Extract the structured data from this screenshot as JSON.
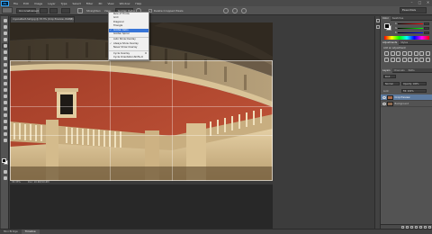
{
  "app": {
    "logo": "Ps"
  },
  "menubar": {
    "items": [
      "File",
      "Edit",
      "Image",
      "Layer",
      "Type",
      "Select",
      "Filter",
      "3D",
      "View",
      "Window",
      "Help"
    ],
    "window_controls": [
      "–",
      "□",
      "✕"
    ]
  },
  "options_bar": {
    "ratio": "Unconstrained",
    "straighten": "Straighten",
    "view": "View:",
    "view_value": "Golden Ratio",
    "delete_cropped": "Delete Cropped Pixels",
    "delete_cropped_checked": true,
    "workspace": "Essentials"
  },
  "overlay_menu": {
    "items": [
      {
        "label": "Rule of Thirds",
        "checked": false,
        "selected": false
      },
      {
        "label": "Grid",
        "checked": false,
        "selected": false
      },
      {
        "label": "Diagonal",
        "checked": false,
        "selected": false
      },
      {
        "label": "Triangle",
        "checked": false,
        "selected": false
      },
      {
        "label": "Golden Ratio",
        "checked": true,
        "selected": true
      },
      {
        "label": "Golden Spiral",
        "checked": false,
        "selected": false
      }
    ],
    "separator_after": 5,
    "items2": [
      {
        "label": "Auto Show Overlay",
        "checked": false
      },
      {
        "label": "Always Show Overlay",
        "checked": true
      },
      {
        "label": "Never Show Overlay",
        "checked": false
      }
    ],
    "items3": [
      {
        "label": "Cycle Overlay",
        "shortcut": "O"
      },
      {
        "label": "Cycle Orientation",
        "shortcut": "Shift+O"
      }
    ]
  },
  "document": {
    "tab_title": "royal-albert-hall.jpg @ 33.3% (Crop Preview, RGB/8)",
    "zoom": "33.33%",
    "doc_info": "Doc: 10.6M/10.6M",
    "photo": "Royal Albert Hall facade"
  },
  "bottom_tabs": [
    "Mini Bridge",
    "Timeline"
  ],
  "active_bottom_tab": 1,
  "right_panel": {
    "color_tabs": [
      "Color",
      "Swatches"
    ],
    "color_channels": [
      "R",
      "G",
      "B"
    ],
    "adjustments_tabs": [
      "Adjustments",
      "Styles"
    ],
    "adjustments_title": "Add an adjustment",
    "layers_tabs": [
      "Layers",
      "Channels",
      "Paths"
    ],
    "kind_filter": "Kind",
    "blend_mode": "Normal",
    "opacity": "Opacity: 100%",
    "lock": "Lock:",
    "fill": "Fill: 100%",
    "layers": [
      {
        "name": "Crop Preview",
        "selected": true
      },
      {
        "name": "Background",
        "selected": false
      }
    ]
  },
  "colors": {
    "ui_dark": "#535353",
    "ui_darker": "#3c3c3c",
    "selection_blue": "#3875d7",
    "brick_red": "#b5452c",
    "stone": "#d8c29a"
  }
}
